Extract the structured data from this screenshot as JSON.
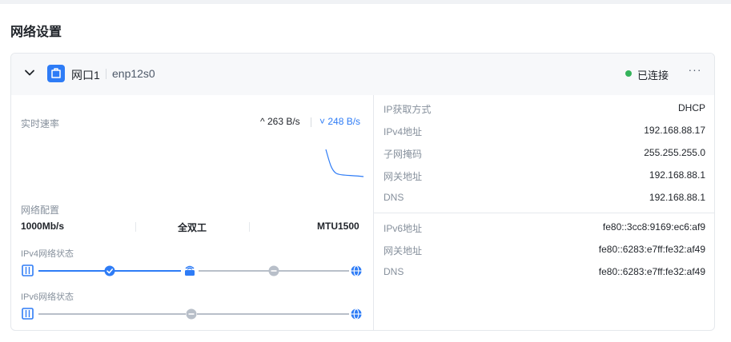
{
  "page": {
    "title": "网络设置"
  },
  "card": {
    "port_name": "网口1",
    "device_name": "enp12s0",
    "status": "已连接",
    "status_color": "#34b35b",
    "more_label": "···"
  },
  "speed": {
    "label": "实时速率",
    "up": "263 B/s",
    "down": "248 B/s",
    "accent": "#2e7cf6"
  },
  "config": {
    "label": "网络配置",
    "rate": "1000Mb/s",
    "duplex": "全双工",
    "mtu": "MTU1500"
  },
  "ipv4_status": {
    "label": "IPv4网络状态",
    "icons": [
      "lan-port-icon",
      "check-circle-icon",
      "router-icon",
      "minus-circle-icon",
      "globe-icon"
    ]
  },
  "ipv6_status": {
    "label": "IPv6网络状态",
    "icons": [
      "lan-port-icon",
      "minus-circle-icon",
      "globe-icon"
    ]
  },
  "ipv4": [
    {
      "key": "IP获取方式",
      "value": "DHCP"
    },
    {
      "key": "IPv4地址",
      "value": "192.168.88.17"
    },
    {
      "key": "子网掩码",
      "value": "255.255.255.0"
    },
    {
      "key": "网关地址",
      "value": "192.168.88.1"
    },
    {
      "key": "DNS",
      "value": "192.168.88.1"
    }
  ],
  "ipv6": [
    {
      "key": "IPv6地址",
      "value": "fe80::3cc8:9169:ec6:af9"
    },
    {
      "key": "网关地址",
      "value": "fe80::6283:e7ff:fe32:af49"
    },
    {
      "key": "DNS",
      "value": "fe80::6283:e7ff:fe32:af49"
    }
  ]
}
